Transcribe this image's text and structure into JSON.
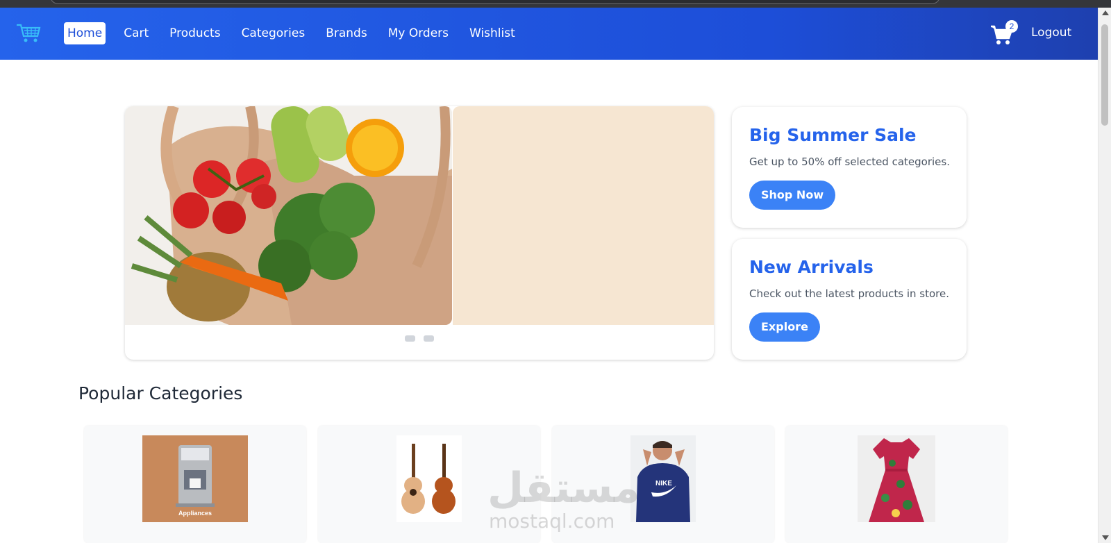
{
  "navbar": {
    "logo_icon": "shopping-cart-logo-icon",
    "links": [
      {
        "label": "Home",
        "active": true
      },
      {
        "label": "Cart",
        "active": false
      },
      {
        "label": "Products",
        "active": false
      },
      {
        "label": "Categories",
        "active": false
      },
      {
        "label": "Brands",
        "active": false
      },
      {
        "label": "My Orders",
        "active": false
      },
      {
        "label": "Wishlist",
        "active": false
      }
    ],
    "cart_count": "2",
    "cart_icon": "cart-icon",
    "logout_label": "Logout",
    "accent_color": "#2563eb"
  },
  "slider": {
    "slide_count": 2,
    "active_slide": 1,
    "image_description_icon": "grocery-bag-image"
  },
  "promos": [
    {
      "title": "Big Summer Sale",
      "text": "Get up to 50% off selected categories.",
      "button": "Shop Now"
    },
    {
      "title": "New Arrivals",
      "text": "Check out the latest products in store.",
      "button": "Explore"
    }
  ],
  "section": {
    "title": "Popular Categories"
  },
  "categories": [
    {
      "image": "appliances-image",
      "image_caption": "Appliances"
    },
    {
      "image": "guitars-image"
    },
    {
      "image": "hoodie-image"
    },
    {
      "image": "dress-image"
    }
  ],
  "watermark": {
    "arabic": "مستقل",
    "latin": "mostaql.com"
  }
}
